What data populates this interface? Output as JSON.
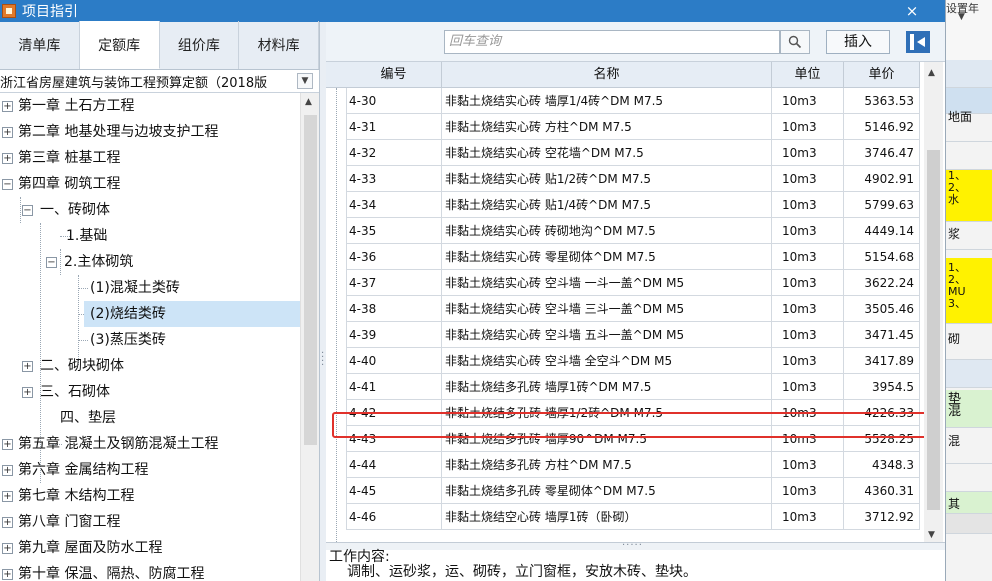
{
  "window": {
    "title": "项目指引",
    "close": "×"
  },
  "tabs": [
    {
      "label": "清单库",
      "active": false
    },
    {
      "label": "定额库",
      "active": true
    },
    {
      "label": "组价库",
      "active": false
    },
    {
      "label": "材料库",
      "active": false
    }
  ],
  "library_select": {
    "value": "浙江省房屋建筑与装饰工程预算定额（2018版"
  },
  "tree": {
    "nodes": [
      {
        "label": "第一章 土石方工程",
        "expander": "+"
      },
      {
        "label": "第二章 地基处理与边坡支护工程",
        "expander": "+"
      },
      {
        "label": "第三章 桩基工程",
        "expander": "+"
      },
      {
        "label": "第四章 砌筑工程",
        "expander": "−"
      },
      {
        "label": "一、砖砌体",
        "expander": "−"
      },
      {
        "label": "1.基础",
        "expander": ""
      },
      {
        "label": "2.主体砌筑",
        "expander": "−"
      },
      {
        "label": "(1)混凝土类砖",
        "expander": ""
      },
      {
        "label": "(2)烧结类砖",
        "expander": ""
      },
      {
        "label": "(3)蒸压类砖",
        "expander": ""
      },
      {
        "label": "二、砌块砌体",
        "expander": "+"
      },
      {
        "label": "三、石砌体",
        "expander": "+"
      },
      {
        "label": "四、垫层",
        "expander": ""
      },
      {
        "label": "第五章 混凝土及钢筋混凝土工程",
        "expander": "+"
      },
      {
        "label": "第六章 金属结构工程",
        "expander": "+"
      },
      {
        "label": "第七章 木结构工程",
        "expander": "+"
      },
      {
        "label": "第八章 门窗工程",
        "expander": "+"
      },
      {
        "label": "第九章 屋面及防水工程",
        "expander": "+"
      },
      {
        "label": "第十章 保温、隔热、防腐工程",
        "expander": "+"
      }
    ]
  },
  "toolbar": {
    "search_placeholder": "回车查询",
    "insert_label": "插入"
  },
  "grid": {
    "headers": [
      "编号",
      "名称",
      "单位",
      "单价"
    ],
    "rows": [
      {
        "code": "4-30",
        "name": "非黏土烧结实心砖 墙厚1/4砖^DM M7.5",
        "unit": "10m3",
        "price": "5363.53"
      },
      {
        "code": "4-31",
        "name": "非黏土烧结实心砖 方柱^DM M7.5",
        "unit": "10m3",
        "price": "5146.92"
      },
      {
        "code": "4-32",
        "name": "非黏土烧结实心砖 空花墙^DM M7.5",
        "unit": "10m3",
        "price": "3746.47"
      },
      {
        "code": "4-33",
        "name": "非黏土烧结实心砖 贴1/2砖^DM M7.5",
        "unit": "10m3",
        "price": "4902.91"
      },
      {
        "code": "4-34",
        "name": "非黏土烧结实心砖 贴1/4砖^DM M7.5",
        "unit": "10m3",
        "price": "5799.63"
      },
      {
        "code": "4-35",
        "name": "非黏土烧结实心砖 砖砌地沟^DM M7.5",
        "unit": "10m3",
        "price": "4449.14"
      },
      {
        "code": "4-36",
        "name": "非黏土烧结实心砖 零星砌体^DM M7.5",
        "unit": "10m3",
        "price": "5154.68"
      },
      {
        "code": "4-37",
        "name": "非黏土烧结实心砖 空斗墙 一斗一盖^DM M5",
        "unit": "10m3",
        "price": "3622.24"
      },
      {
        "code": "4-38",
        "name": "非黏土烧结实心砖 空斗墙 三斗一盖^DM M5",
        "unit": "10m3",
        "price": "3505.46"
      },
      {
        "code": "4-39",
        "name": "非黏土烧结实心砖 空斗墙 五斗一盖^DM M5",
        "unit": "10m3",
        "price": "3471.45"
      },
      {
        "code": "4-40",
        "name": "非黏土烧结实心砖 空斗墙 全空斗^DM M5",
        "unit": "10m3",
        "price": "3417.89"
      },
      {
        "code": "4-41",
        "name": "非黏土烧结多孔砖 墙厚1砖^DM M7.5",
        "unit": "10m3",
        "price": "3954.5"
      },
      {
        "code": "4-42",
        "name": "非黏土烧结多孔砖 墙厚1/2砖^DM M7.5",
        "unit": "10m3",
        "price": "4226.33"
      },
      {
        "code": "4-43",
        "name": "非黏土烧结多孔砖 墙厚90^DM M7.5",
        "unit": "10m3",
        "price": "5528.25"
      },
      {
        "code": "4-44",
        "name": "非黏土烧结多孔砖 方柱^DM M7.5",
        "unit": "10m3",
        "price": "4348.3"
      },
      {
        "code": "4-45",
        "name": "非黏土烧结多孔砖 零星砌体^DM M7.5",
        "unit": "10m3",
        "price": "4360.31"
      },
      {
        "code": "4-46",
        "name": "非黏土烧结空心砖 墙厚1砖（卧砌）",
        "unit": "10m3",
        "price": "3712.92"
      }
    ]
  },
  "work": {
    "label": "工作内容:",
    "text": "调制、运砂浆，运、砌砖，立门窗框，安放木砖、垫块。"
  },
  "background_app": {
    "top_label": "设置年",
    "cells": [
      "地面",
      "1、\n2、\n水",
      "浆",
      "1、\n2、\nMU\n3、",
      "砌",
      "垫\n混",
      "混",
      "其"
    ]
  },
  "colors": {
    "titlebar": "#2c7cc6",
    "highlight": "#e0312b",
    "selected": "#cde4f7",
    "bg_yellow": "#fff200",
    "bg_green": "#d9f2d0"
  }
}
